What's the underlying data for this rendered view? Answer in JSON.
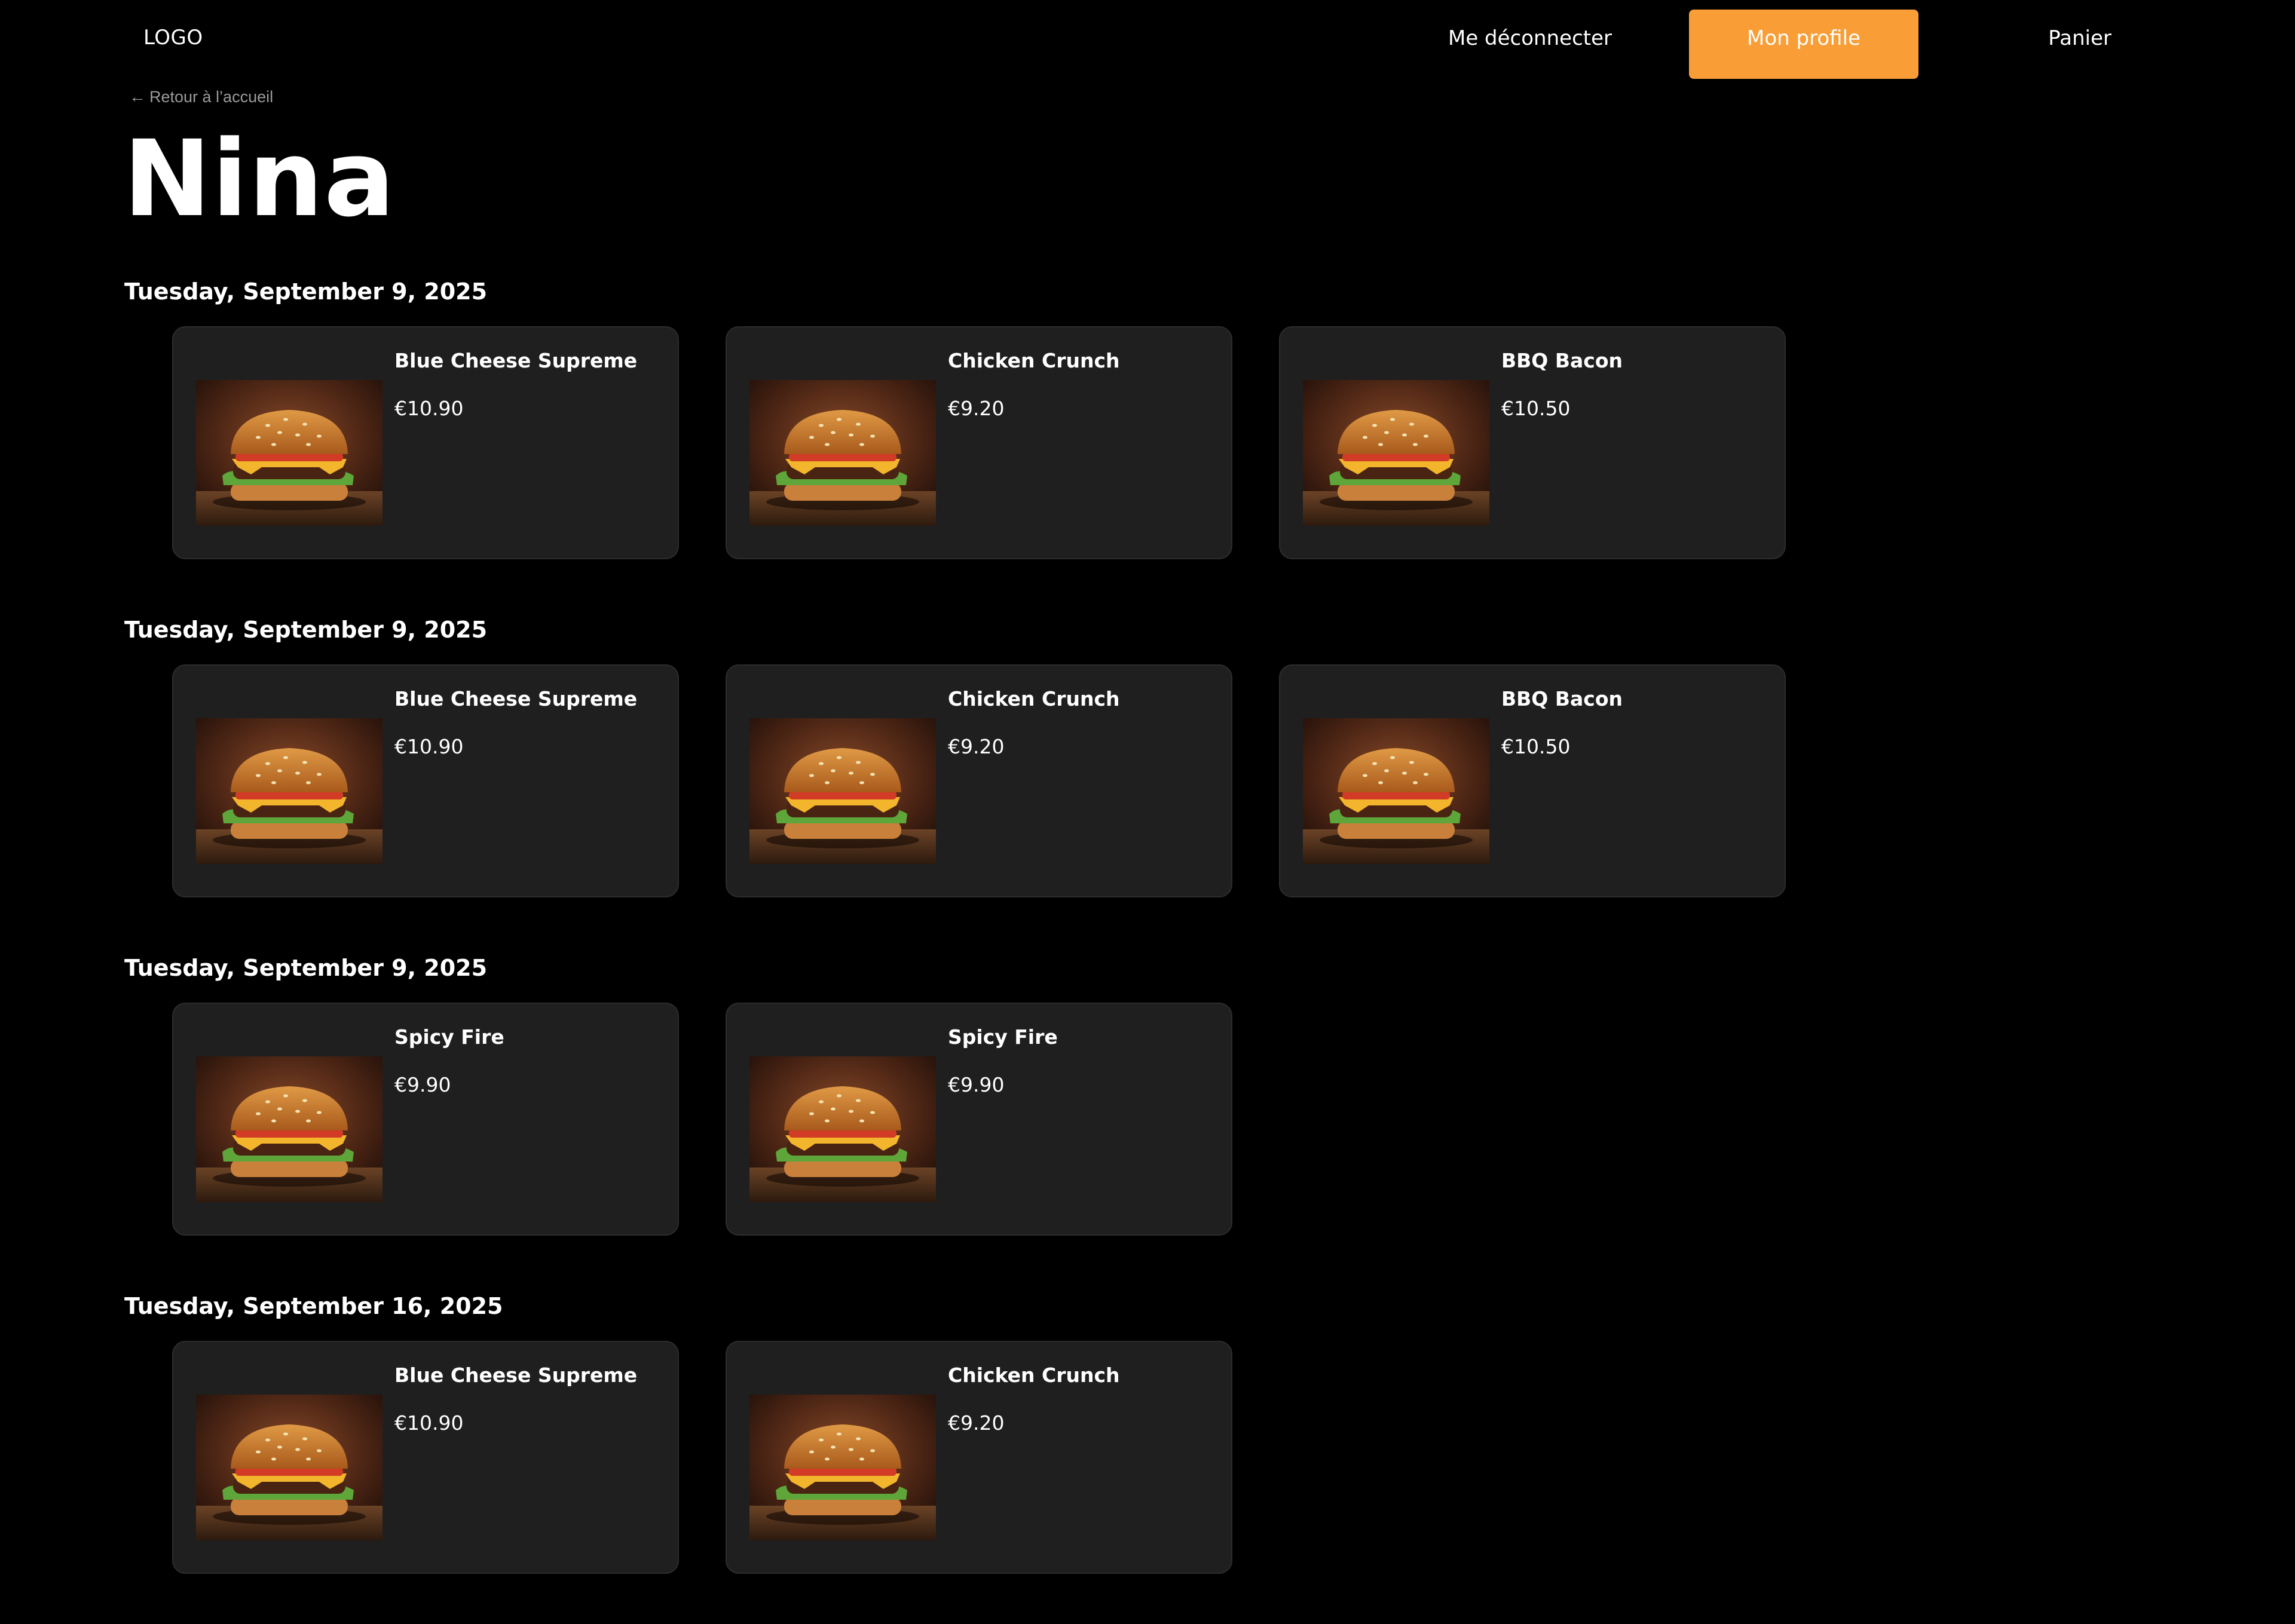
{
  "header": {
    "logo": "LOGO",
    "nav": {
      "logout": "Me déconnecter",
      "profile": "Mon profile",
      "cart": "Panier"
    },
    "accent_color": "#f99e37"
  },
  "back_link": {
    "icon": "arrow-left-icon",
    "label": "Retour à l’accueil"
  },
  "title": "Nina",
  "orders": [
    {
      "date": "Tuesday, September 9, 2025",
      "items": [
        {
          "name": "Blue Cheese Supreme",
          "price": "€10.90",
          "image": "burger-image"
        },
        {
          "name": "Chicken Crunch",
          "price": "€9.20",
          "image": "burger-image"
        },
        {
          "name": "BBQ Bacon",
          "price": "€10.50",
          "image": "burger-image"
        }
      ]
    },
    {
      "date": "Tuesday, September 9, 2025",
      "items": [
        {
          "name": "Blue Cheese Supreme",
          "price": "€10.90",
          "image": "burger-image"
        },
        {
          "name": "Chicken Crunch",
          "price": "€9.20",
          "image": "burger-image"
        },
        {
          "name": "BBQ Bacon",
          "price": "€10.50",
          "image": "burger-image"
        }
      ]
    },
    {
      "date": "Tuesday, September 9, 2025",
      "items": [
        {
          "name": "Spicy Fire",
          "price": "€9.90",
          "image": "burger-image"
        },
        {
          "name": "Spicy Fire",
          "price": "€9.90",
          "image": "burger-image"
        }
      ]
    },
    {
      "date": "Tuesday, September 16, 2025",
      "items": [
        {
          "name": "Blue Cheese Supreme",
          "price": "€10.90",
          "image": "burger-image"
        },
        {
          "name": "Chicken Crunch",
          "price": "€9.20",
          "image": "burger-image"
        }
      ]
    }
  ]
}
